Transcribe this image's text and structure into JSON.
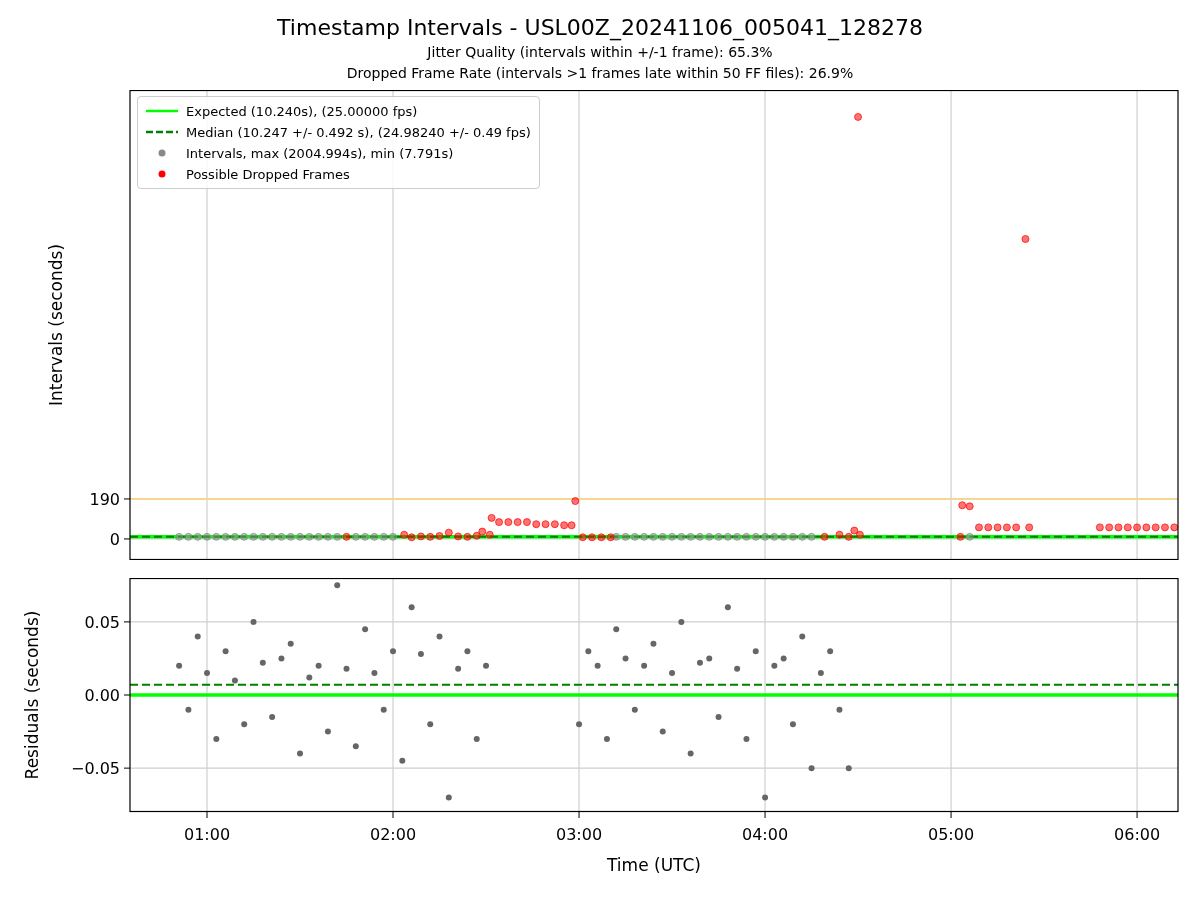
{
  "figure": {
    "title": "Timestamp Intervals - USL00Z_20241106_005041_128278",
    "subtitles": [
      "Jitter Quality (intervals within +/-1 frame): 65.3%",
      "Dropped Frame Rate (intervals >1 frames late within 50 FF files): 26.9%"
    ]
  },
  "charts": [
    {
      "chart_data": {
        "type": "scatter",
        "ylabel": "Intervals (seconds)",
        "xlim": [
          0.586,
          6.22
        ],
        "ylim": [
          -100,
          2133
        ],
        "grid": true,
        "yticks": [
          {
            "value": 0,
            "label": "0"
          },
          {
            "value": 190,
            "label": "190"
          }
        ],
        "ref_lines": [
          {
            "axis": "y",
            "value": 10.24,
            "label": "Expected (10.240s), (25.00000 fps)",
            "color": "#00ff00"
          },
          {
            "axis": "y",
            "value": 10.247,
            "label": "Median (10.247 +/- 0.492 s), (24.98240 +/- 0.49 fps)",
            "color": "#008000"
          },
          {
            "axis": "y",
            "value": 190,
            "color": "#ffd37a"
          }
        ],
        "series": [
          {
            "name": "Intervals, max (2004.994s), min (7.791s)",
            "color": "#888888",
            "x": [
              0.85,
              0.9,
              0.95,
              1.0,
              1.05,
              1.1,
              1.15,
              1.2,
              1.25,
              1.3,
              1.35,
              1.4,
              1.45,
              1.5,
              1.55,
              1.6,
              1.65,
              1.7,
              1.8,
              1.85,
              1.9,
              1.95,
              2.0,
              3.2,
              3.25,
              3.3,
              3.35,
              3.4,
              3.45,
              3.5,
              3.55,
              3.6,
              3.65,
              3.7,
              3.75,
              3.8,
              3.85,
              3.9,
              3.95,
              4.0,
              4.05,
              4.1,
              4.15,
              4.2,
              4.25,
              5.1
            ],
            "values": [
              10,
              10,
              10,
              10,
              10,
              10,
              10,
              10,
              10,
              10,
              10,
              10,
              10,
              10,
              10,
              10,
              10,
              10,
              10,
              10,
              10,
              10,
              10,
              10,
              10,
              10,
              10,
              10,
              10,
              10,
              10,
              10,
              10,
              10,
              10,
              10,
              10,
              10,
              10,
              10,
              10,
              10,
              10,
              10,
              10,
              10
            ]
          },
          {
            "name": "Possible Dropped Frames",
            "color": "#ff0000",
            "x": [
              1.75,
              2.06,
              2.1,
              2.15,
              2.2,
              2.25,
              2.3,
              2.35,
              2.4,
              2.45,
              2.48,
              2.52,
              2.53,
              2.57,
              2.62,
              2.67,
              2.72,
              2.77,
              2.82,
              2.87,
              2.92,
              2.96,
              2.98,
              3.02,
              3.07,
              3.12,
              3.17,
              4.32,
              4.4,
              4.45,
              4.48,
              4.5,
              4.51,
              5.05,
              5.06,
              5.1,
              5.15,
              5.2,
              5.25,
              5.3,
              5.35,
              5.4,
              5.42,
              5.8,
              5.85,
              5.9,
              5.95,
              6.0,
              6.05,
              6.1,
              6.15,
              6.2
            ],
            "values": [
              10,
              20,
              8,
              12,
              10,
              14,
              30,
              12,
              10,
              15,
              35,
              20,
              100,
              80,
              80,
              80,
              80,
              70,
              70,
              70,
              65,
              65,
              180,
              8,
              8,
              8,
              8,
              10,
              20,
              10,
              40,
              2005,
              20,
              10,
              160,
              155,
              55,
              55,
              55,
              55,
              55,
              1425,
              55,
              55,
              55,
              55,
              55,
              55,
              55,
              55,
              55,
              55
            ]
          }
        ]
      }
    },
    {
      "chart_data": {
        "type": "scatter",
        "xlabel": "Time (UTC)",
        "ylabel": "Residuals (seconds)",
        "xlim": [
          0.586,
          6.22
        ],
        "ylim": [
          -0.08,
          0.08
        ],
        "grid": true,
        "xticks": [
          {
            "value": 1,
            "label": "01:00"
          },
          {
            "value": 2,
            "label": "02:00"
          },
          {
            "value": 3,
            "label": "03:00"
          },
          {
            "value": 4,
            "label": "04:00"
          },
          {
            "value": 5,
            "label": "05:00"
          },
          {
            "value": 6,
            "label": "06:00"
          }
        ],
        "yticks": [
          {
            "value": -0.05,
            "label": "−0.05"
          },
          {
            "value": 0,
            "label": "0.00"
          },
          {
            "value": 0.05,
            "label": "0.05"
          }
        ],
        "ref_lines": [
          {
            "axis": "y",
            "value": 0,
            "color": "#00ff00"
          },
          {
            "axis": "y",
            "value": 0.007,
            "color": "#008000"
          }
        ],
        "x": [
          0.85,
          0.9,
          0.95,
          1.0,
          1.05,
          1.1,
          1.15,
          1.2,
          1.25,
          1.3,
          1.35,
          1.4,
          1.45,
          1.5,
          1.55,
          1.6,
          1.65,
          1.7,
          1.75,
          1.8,
          1.85,
          1.9,
          1.95,
          2.0,
          2.05,
          2.1,
          2.15,
          2.2,
          2.25,
          2.3,
          2.35,
          2.4,
          2.45,
          2.5,
          3.0,
          3.05,
          3.1,
          3.15,
          3.2,
          3.25,
          3.3,
          3.35,
          3.4,
          3.45,
          3.5,
          3.55,
          3.6,
          3.65,
          3.7,
          3.75,
          3.8,
          3.85,
          3.9,
          3.95,
          4.0,
          4.05,
          4.1,
          4.15,
          4.2,
          4.25,
          4.3,
          4.35,
          4.4,
          4.45
        ],
        "series": [
          {
            "color": "#666666",
            "values": [
              0.02,
              -0.01,
              0.04,
              0.015,
              -0.03,
              0.03,
              0.01,
              -0.02,
              0.05,
              0.022,
              -0.015,
              0.025,
              0.035,
              -0.04,
              0.012,
              0.02,
              -0.025,
              0.075,
              0.018,
              -0.035,
              0.045,
              0.015,
              -0.01,
              0.03,
              -0.045,
              0.06,
              0.028,
              -0.02,
              0.04,
              -0.07,
              0.018,
              0.03,
              -0.03,
              0.02,
              -0.02,
              0.03,
              0.02,
              -0.03,
              0.045,
              0.025,
              -0.01,
              0.02,
              0.035,
              -0.025,
              0.015,
              0.05,
              -0.04,
              0.022,
              0.025,
              -0.015,
              0.06,
              0.018,
              -0.03,
              0.03,
              -0.07,
              0.02,
              0.025,
              -0.02,
              0.04,
              -0.05,
              0.015,
              0.03,
              -0.01,
              -0.05
            ]
          }
        ]
      }
    }
  ]
}
